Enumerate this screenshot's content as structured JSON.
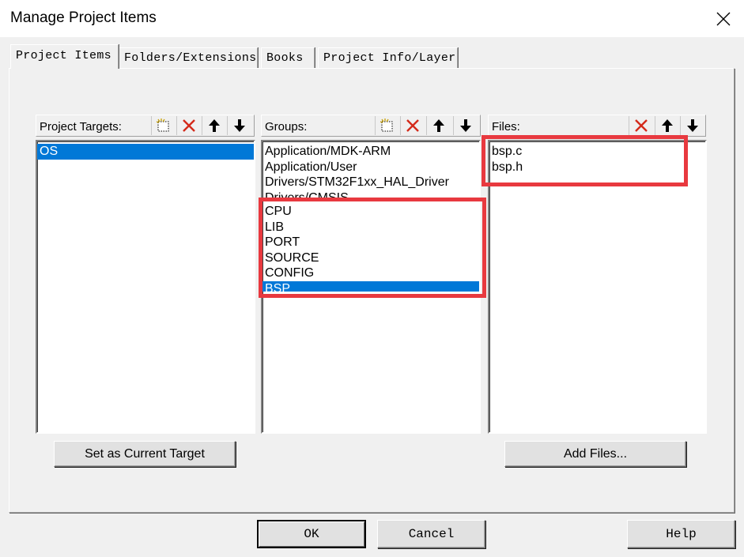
{
  "window": {
    "title": "Manage Project Items"
  },
  "tabs": [
    {
      "label": "Project Items"
    },
    {
      "label": "Folders/Extensions"
    },
    {
      "label": "Books"
    },
    {
      "label": "Project Info/Layer"
    }
  ],
  "targets": {
    "header": "Project Targets:",
    "items": [
      "OS"
    ],
    "selected": "OS",
    "set_current_label": "Set as Current Target"
  },
  "groups": {
    "header": "Groups:",
    "items": [
      "Application/MDK-ARM",
      "Application/User",
      "Drivers/STM32F1xx_HAL_Driver",
      "Drivers/CMSIS",
      "CPU",
      "LIB",
      "PORT",
      "SOURCE",
      "CONFIG",
      "BSP"
    ],
    "selected": "BSP"
  },
  "files": {
    "header": "Files:",
    "items": [
      "bsp.c",
      "bsp.h"
    ],
    "add_files_label": "Add Files..."
  },
  "footer": {
    "ok_label": "OK",
    "cancel_label": "Cancel",
    "help_label": "Help"
  },
  "colors": {
    "selection": "#0078d7",
    "highlight_box": "#e8393f",
    "delete_icon": "#d42a1a"
  },
  "icons": {
    "new": "new-item-icon",
    "delete": "delete-icon",
    "up": "arrow-up-icon",
    "down": "arrow-down-icon",
    "close": "close-icon"
  }
}
